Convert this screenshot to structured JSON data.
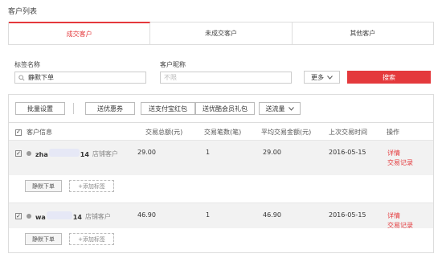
{
  "page_title": "客户列表",
  "tabs": [
    {
      "label": "成交客户",
      "active": true
    },
    {
      "label": "未成交客户",
      "active": false
    },
    {
      "label": "其他客户",
      "active": false
    }
  ],
  "filters": {
    "tag_label": "标签名称",
    "tag_value": "静默下单",
    "nickname_label": "客户昵称",
    "nickname_placeholder": "不限",
    "more_label": "更多",
    "search_label": "搜索"
  },
  "toolbar": {
    "batch": "批量设置",
    "coupon": "送优惠券",
    "alipay_redpack": "送支付宝红包",
    "member_gift": "送优酷会员礼包",
    "traffic": "送流量"
  },
  "table": {
    "headers": [
      "客户信息",
      "交易总额(元)",
      "交易笔数(笔)",
      "平均交易金额(元)",
      "上次交易时间",
      "操作"
    ],
    "rows": [
      {
        "name_start": "zha",
        "name_end": "14",
        "store": "店铺客户",
        "total": "29.00",
        "count": "1",
        "avg": "29.00",
        "last": "2016-05-15",
        "detail": "详情",
        "record": "交易记录",
        "tag": "静默下单",
        "add_tag": "+添加标签"
      },
      {
        "name_start": "wa",
        "name_end": "14",
        "store": "店铺客户",
        "total": "46.90",
        "count": "1",
        "avg": "46.90",
        "last": "2016-05-15",
        "detail": "详情",
        "record": "交易记录",
        "tag": "静默下单",
        "add_tag": "+添加标签"
      }
    ]
  },
  "colors": {
    "accent": "#e4393c",
    "row_bg": "#f2f2f2"
  }
}
